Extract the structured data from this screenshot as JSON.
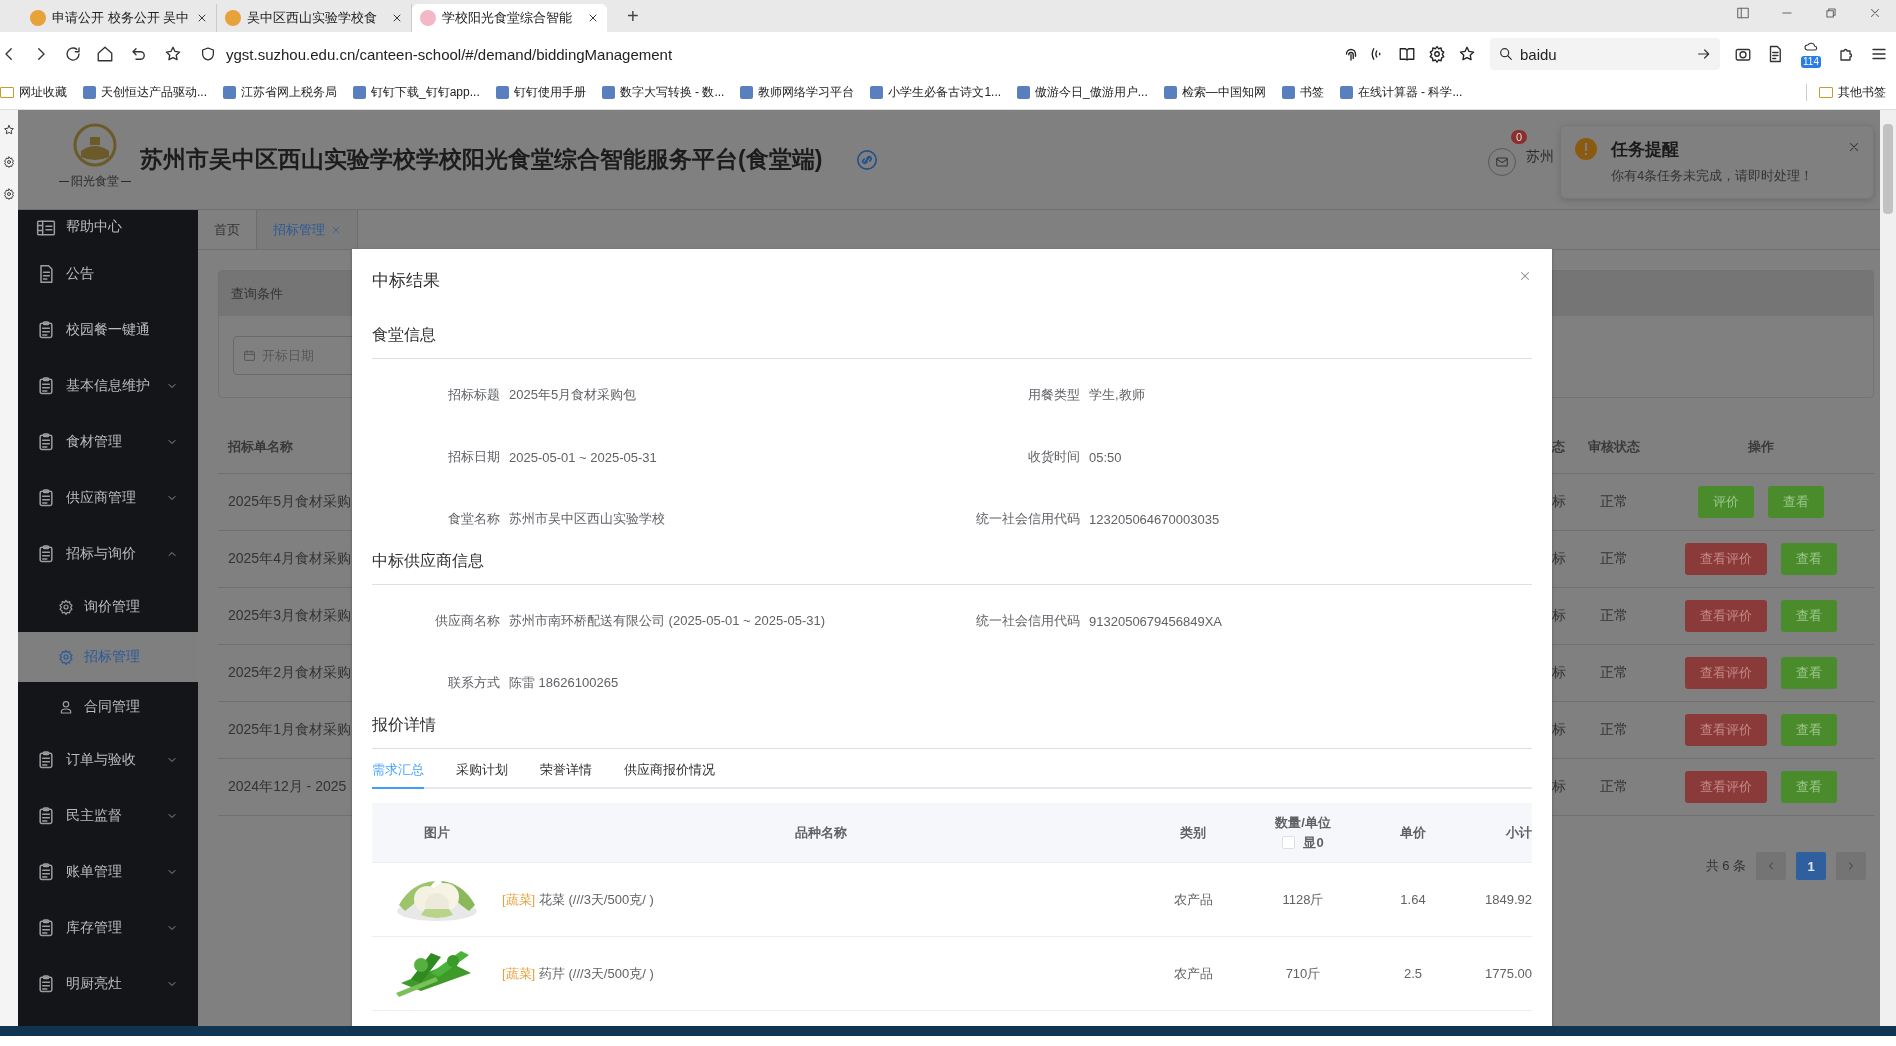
{
  "browser": {
    "tabs": [
      {
        "title": "申请公开 校务公开 吴中",
        "selected": false
      },
      {
        "title": "吴中区西山实验学校食",
        "selected": false
      },
      {
        "title": "学校阳光食堂综合智能",
        "selected": true
      }
    ],
    "new_tab": "+",
    "url": "ygst.suzhou.edu.cn/canteen-school/#/demand/biddingManagement",
    "search": {
      "value": "baidu"
    },
    "extension_badge": "114",
    "bookmarks": [
      {
        "label": "网址收藏"
      },
      {
        "label": "天创恒达产品驱动..."
      },
      {
        "label": "江苏省网上税务局"
      },
      {
        "label": "钉钉下载_钉钉app..."
      },
      {
        "label": "钉钉使用手册"
      },
      {
        "label": "数字大写转换 - 数..."
      },
      {
        "label": "教师网络学习平台"
      },
      {
        "label": "小学生必备古诗文1..."
      },
      {
        "label": "傲游今日_傲游用户..."
      },
      {
        "label": "检索—中国知网"
      },
      {
        "label": "书签"
      },
      {
        "label": "在线计算器 - 科学..."
      }
    ],
    "other_bookmarks": "其他书签"
  },
  "header": {
    "logo_caption": "阳光食堂",
    "title": "苏州市吴中区西山实验学校学校阳光食堂综合智能服务平台(食堂端)",
    "mail_badge": "0",
    "user": "苏州"
  },
  "notification": {
    "title": "任务提醒",
    "message": "你有4条任务未完成，请即时处理！"
  },
  "sidebar": {
    "items": [
      {
        "label": "帮助中心",
        "kind": "link",
        "selected": false
      },
      {
        "label": "公告",
        "kind": "link",
        "selected": false
      },
      {
        "label": "校园餐一键通",
        "kind": "link",
        "selected": false
      },
      {
        "label": "基本信息维护",
        "kind": "group",
        "expanded": false,
        "selected": false
      },
      {
        "label": "食材管理",
        "kind": "group",
        "expanded": false,
        "selected": false
      },
      {
        "label": "供应商管理",
        "kind": "group",
        "expanded": false,
        "selected": false
      },
      {
        "label": "招标与询价",
        "kind": "group",
        "expanded": true,
        "selected": false,
        "children": [
          {
            "label": "询价管理",
            "selected": false
          },
          {
            "label": "招标管理",
            "selected": true
          },
          {
            "label": "合同管理",
            "selected": false
          }
        ]
      },
      {
        "label": "订单与验收",
        "kind": "group",
        "expanded": false,
        "selected": false
      },
      {
        "label": "民主监督",
        "kind": "group",
        "expanded": false,
        "selected": false
      },
      {
        "label": "账单管理",
        "kind": "group",
        "expanded": false,
        "selected": false
      },
      {
        "label": "库存管理",
        "kind": "group",
        "expanded": false,
        "selected": false
      },
      {
        "label": "明厨亮灶",
        "kind": "group",
        "expanded": false,
        "selected": false
      }
    ]
  },
  "page_tabs": [
    {
      "label": "首页",
      "selected": false,
      "closable": false
    },
    {
      "label": "招标管理",
      "selected": true,
      "closable": true
    }
  ],
  "query": {
    "title": "查询条件",
    "date_placeholder": "开标日期"
  },
  "bidding_table": {
    "columns": [
      "招标单名称",
      "态",
      "审核状态",
      "操作"
    ],
    "rows": [
      {
        "name": "2025年5月食材采购",
        "status": "标",
        "audit": "正常",
        "actions": [
          {
            "label": "评价",
            "kind": "success"
          },
          {
            "label": "查看",
            "kind": "success"
          }
        ]
      },
      {
        "name": "2025年4月食材采购",
        "status": "标",
        "audit": "正常",
        "actions": [
          {
            "label": "查看评价",
            "kind": "danger"
          },
          {
            "label": "查看",
            "kind": "success"
          }
        ]
      },
      {
        "name": "2025年3月食材采购",
        "status": "标",
        "audit": "正常",
        "actions": [
          {
            "label": "查看评价",
            "kind": "danger"
          },
          {
            "label": "查看",
            "kind": "success"
          }
        ]
      },
      {
        "name": "2025年2月食材采购",
        "status": "标",
        "audit": "正常",
        "actions": [
          {
            "label": "查看评价",
            "kind": "danger"
          },
          {
            "label": "查看",
            "kind": "success"
          }
        ]
      },
      {
        "name": "2025年1月食材采购",
        "status": "标",
        "audit": "正常",
        "actions": [
          {
            "label": "查看评价",
            "kind": "danger"
          },
          {
            "label": "查看",
            "kind": "success"
          }
        ]
      },
      {
        "name": "2024年12月 - 2025",
        "status": "标",
        "audit": "正常",
        "actions": [
          {
            "label": "查看评价",
            "kind": "danger"
          },
          {
            "label": "查看",
            "kind": "success"
          }
        ]
      }
    ]
  },
  "pagination": {
    "total": "共 6 条",
    "pages": [
      {
        "label": "1",
        "selected": true
      }
    ]
  },
  "modal": {
    "title": "中标结果",
    "sections": [
      {
        "title": "食堂信息",
        "fields": [
          {
            "label": "招标标题",
            "value": "2025年5月食材采购包"
          },
          {
            "label": "用餐类型",
            "value": "学生,教师"
          },
          {
            "label": "招标日期",
            "value": "2025-05-01 ~ 2025-05-31"
          },
          {
            "label": "收货时间",
            "value": "05:50"
          },
          {
            "label": "食堂名称",
            "value": "苏州市吴中区西山实验学校"
          },
          {
            "label": "统一社会信用代码",
            "value": "123205064670003035"
          }
        ]
      },
      {
        "title": "中标供应商信息",
        "fields": [
          {
            "label": "供应商名称",
            "value": "苏州市南环桥配送有限公司 (2025-05-01 ~ 2025-05-31)"
          },
          {
            "label": "统一社会信用代码",
            "value": "9132050679456849XA"
          },
          {
            "label": "联系方式",
            "value": "陈雷 18626100265"
          }
        ]
      }
    ],
    "quote": {
      "title": "报价详情",
      "tabs": [
        {
          "label": "需求汇总",
          "selected": true
        },
        {
          "label": "采购计划",
          "selected": false
        },
        {
          "label": "荣誉详情",
          "selected": false
        },
        {
          "label": "供应商报价情况",
          "selected": false
        }
      ],
      "table": {
        "columns": [
          "图片",
          "品种名称",
          "类别",
          "数量/单位",
          "单价",
          "小计"
        ],
        "zero_toggle": {
          "label": "显0",
          "checked": false
        },
        "rows": [
          {
            "tag": "[蔬菜]",
            "name": "花菜 (///3天/500克/ )",
            "category": "农产品",
            "quantity": "1128斤",
            "price": "1.64",
            "subtotal": "1849.92"
          },
          {
            "tag": "[蔬菜]",
            "name": "药芹 (///3天/500克/ )",
            "category": "农产品",
            "quantity": "710斤",
            "price": "2.5",
            "subtotal": "1775.00"
          }
        ]
      }
    }
  }
}
